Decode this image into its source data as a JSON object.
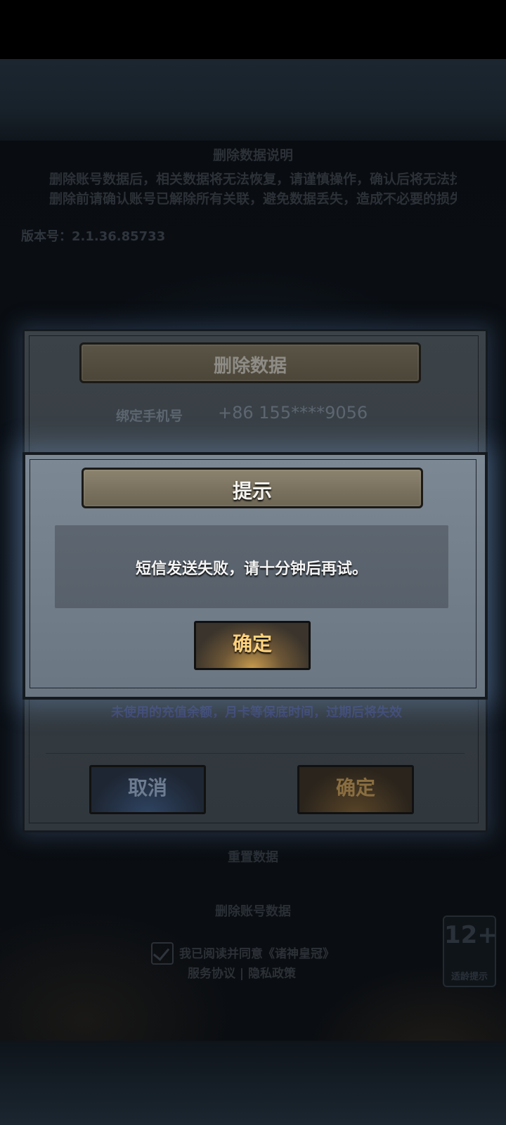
{
  "background": {
    "notice_title": "删除数据说明",
    "notice_line_1": "删除账号数据后，相关数据将无法恢复，请谨慎操作，确认后将无法找回。",
    "notice_line_2": "删除前请确认账号已解除所有关联，避免数据丢失，造成不必要的损失。",
    "version": "版本号：2.1.36.85733",
    "reset_data": "重置数据",
    "delete_account_data": "删除账号数据",
    "agree_text": "我已阅读并同意《诸神皇冠》",
    "agree_links": "服务协议 | 隐私政策",
    "footer": "",
    "age_rating": {
      "number": "12+",
      "label": "适龄提示"
    }
  },
  "delete_dialog": {
    "title": "删除数据",
    "phone_label": "绑定手机号",
    "phone_value": "+86  155****9056",
    "hint": "未使用的充值余额，月卡等保底时间，过期后将失效",
    "cancel_label": "取消",
    "confirm_label": "确定"
  },
  "prompt_dialog": {
    "title": "提示",
    "message": "短信发送失败，请十分钟后再试。",
    "ok_label": "确定"
  }
}
